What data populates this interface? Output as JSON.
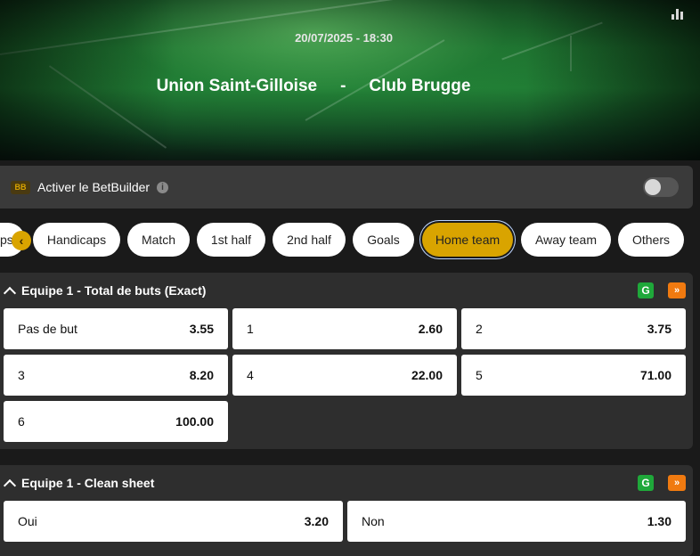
{
  "header": {
    "date": "20/07/2025 - 18:30",
    "home_team": "Union Saint-Gilloise",
    "separator": "-",
    "away_team": "Club Brugge"
  },
  "betbuilder": {
    "badge": "BB",
    "label": "Activer le BetBuilder",
    "info": "i",
    "enabled": false
  },
  "tabs": {
    "partial_label": "ps",
    "prev_arrow": "‹",
    "items": [
      "Handicaps",
      "Match",
      "1st half",
      "2nd half",
      "Goals",
      "Home team",
      "Away team",
      "Others"
    ],
    "active": "Home team"
  },
  "markets": [
    {
      "title": "Equipe 1 - Total de buts (Exact)",
      "g_icon": "G",
      "ff_icon": "»",
      "odds": [
        {
          "label": "Pas de but",
          "value": "3.55"
        },
        {
          "label": "1",
          "value": "2.60"
        },
        {
          "label": "2",
          "value": "3.75"
        },
        {
          "label": "3",
          "value": "8.20"
        },
        {
          "label": "4",
          "value": "22.00"
        },
        {
          "label": "5",
          "value": "71.00"
        },
        {
          "label": "6",
          "value": "100.00"
        }
      ]
    },
    {
      "title": "Equipe 1 - Clean sheet",
      "g_icon": "G",
      "ff_icon": "»",
      "odds": [
        {
          "label": "Oui",
          "value": "3.20"
        },
        {
          "label": "Non",
          "value": "1.30"
        }
      ]
    }
  ],
  "colors": {
    "accent": "#d9a400",
    "background": "#1a1a1a",
    "panel": "#2e2e2e",
    "green_badge": "#1fa83a",
    "orange_badge": "#f07a10"
  }
}
